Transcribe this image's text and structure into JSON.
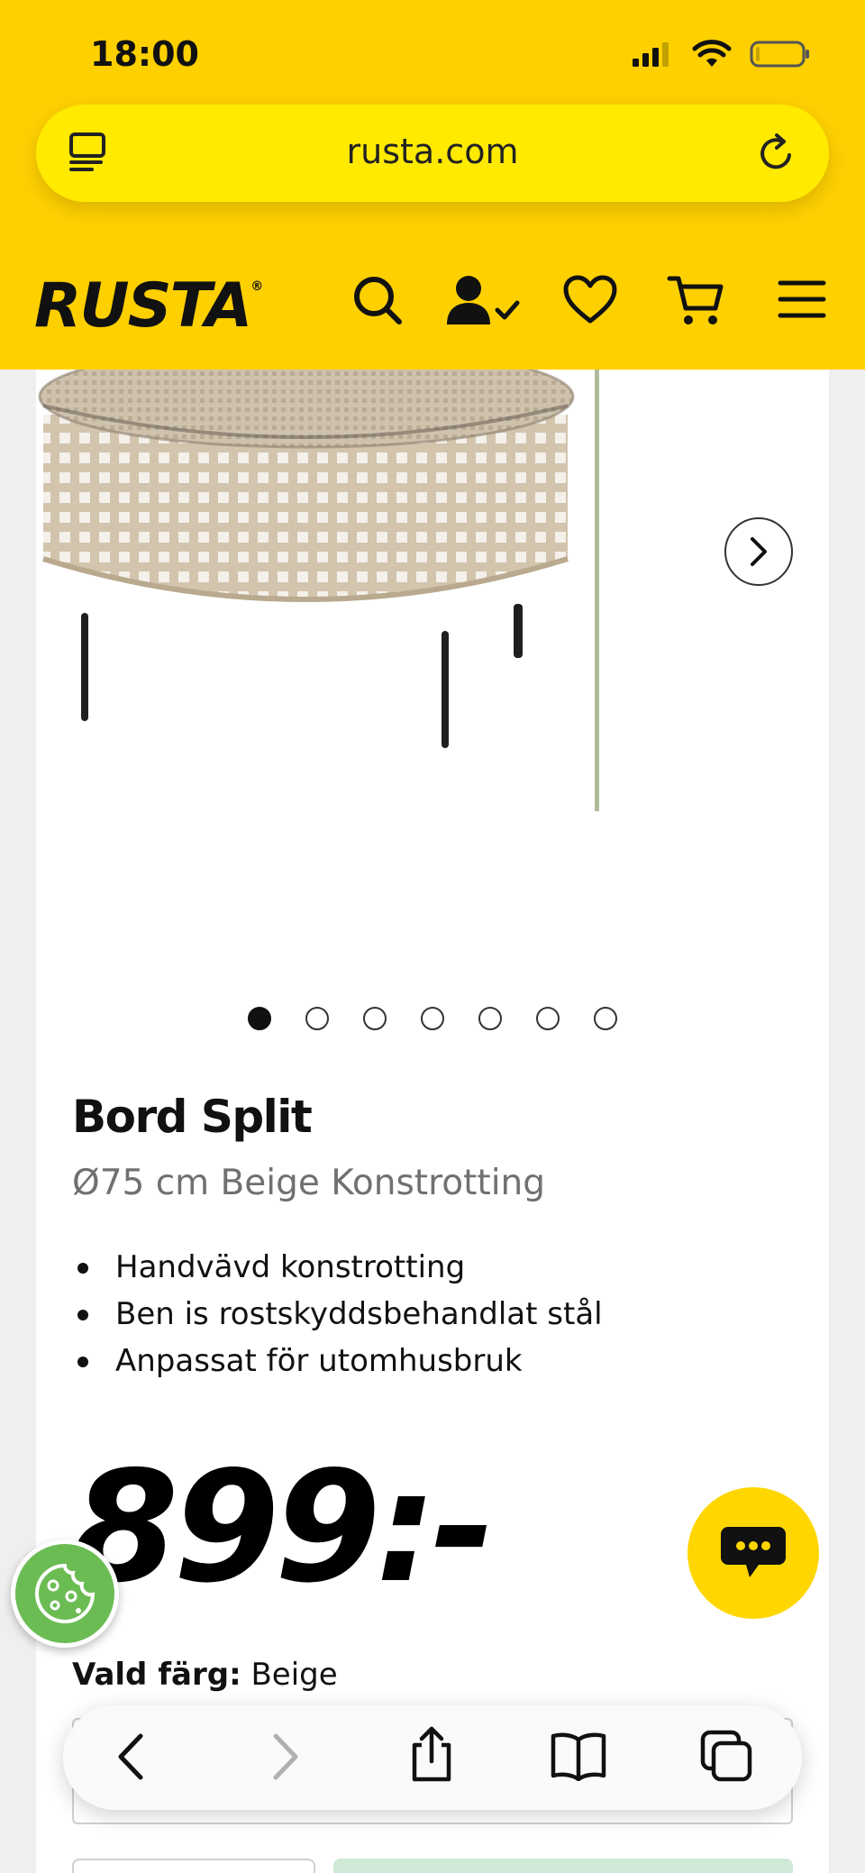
{
  "status_bar": {
    "time": "18:00"
  },
  "browser": {
    "url": "rusta.com"
  },
  "site": {
    "logo": "RUSTA",
    "logo_mark": "®"
  },
  "product": {
    "title": "Bord Split",
    "subtitle": "Ø75 cm Beige Konstrotting",
    "features": [
      "Handvävd konstrotting",
      "Ben is rostskyddsbehandlat stål",
      "Anpassat för utomhusbruk"
    ],
    "price": "899:-",
    "color_label": "Vald färg:",
    "color_value": "Beige",
    "gallery_count": 7,
    "gallery_active_index": 0
  },
  "colors": {
    "brand_yellow": "#ffd000",
    "url_bar": "#ffea00",
    "chat_button": "#ffd600",
    "cookie_button": "#6cbc54"
  },
  "icons": {
    "header": [
      "search-icon",
      "account-icon",
      "heart-icon",
      "cart-icon",
      "menu-icon"
    ],
    "toolbar": [
      "back-icon",
      "forward-icon",
      "share-icon",
      "bookmarks-icon",
      "tabs-icon"
    ]
  }
}
